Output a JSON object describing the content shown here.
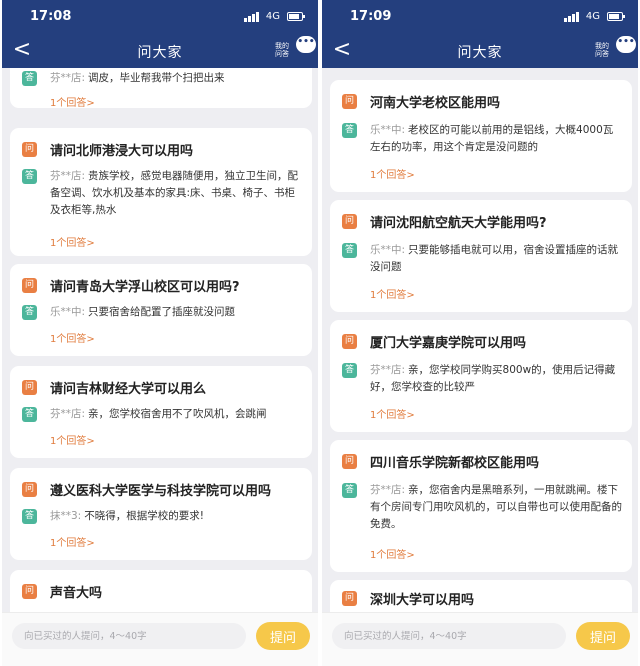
{
  "left": {
    "status": {
      "time": "17:08",
      "network": "4G"
    },
    "nav": {
      "back": "<",
      "title": "问大家",
      "my_questions": "我的问答",
      "chat": "•••"
    },
    "cards": [
      {
        "answer_user": "芬**店:",
        "answer": "调皮，毕业帮我带个扫把出来",
        "count": "1个回答>"
      },
      {
        "question": "请问北师港浸大可以用吗",
        "answer_user": "芬**店:",
        "answer": "贵族学校，感觉电器随便用，独立卫生间，配备空调、饮水机及基本的家具:床、书桌、椅子、书柜及衣柜等,热水",
        "count": "1个回答>"
      },
      {
        "question": "请问青岛大学浮山校区可以用吗?",
        "answer_user": "乐**中:",
        "answer": "只要宿舍给配置了插座就没问题",
        "count": "1个回答>"
      },
      {
        "question": "请问吉林财经大学可以用么",
        "answer_user": "芬**店:",
        "answer": "亲，您学校宿舍用不了吹风机，会跳闸",
        "count": "1个回答>"
      },
      {
        "question": "遵义医科大学医学与科技学院可以用吗",
        "answer_user": "抹**3:",
        "answer": "不晓得，根据学校的要求!",
        "count": "1个回答>"
      },
      {
        "question": "声音大吗"
      }
    ],
    "bottom": {
      "placeholder": "向已买过的人提问，4～40字",
      "ask": "提问"
    }
  },
  "right": {
    "status": {
      "time": "17:09",
      "network": "4G"
    },
    "nav": {
      "back": "<",
      "title": "问大家",
      "my_questions": "我的问答",
      "chat": "•••"
    },
    "cards": [
      {
        "question": "河南大学老校区能用吗",
        "answer_user": "乐**中:",
        "answer": "老校区的可能以前用的是铝线，大概4000瓦左右的功率，用这个肯定是没问题的",
        "count": "1个回答>"
      },
      {
        "question": "请问沈阳航空航天大学能用吗?",
        "answer_user": "乐**中:",
        "answer": "只要能够插电就可以用，宿舍设置插座的话就没问题",
        "count": "1个回答>"
      },
      {
        "question": "厦门大学嘉庚学院可以用吗",
        "answer_user": "芬**店:",
        "answer": "亲，您学校同学购买800w的，使用后记得藏好，您学校查的比较严",
        "count": "1个回答>"
      },
      {
        "question": "四川音乐学院新都校区能用吗",
        "answer_user": "芬**店:",
        "answer": "亲，您宿舍内是黑暗系列，一用就跳闸。楼下有个房间专门用吹风机的，可以自带也可以使用配备的免费。",
        "count": "1个回答>"
      },
      {
        "question": "深圳大学可以用吗"
      }
    ],
    "bottom": {
      "placeholder": "向已买过的人提问，4～40字",
      "ask": "提问"
    }
  },
  "badges": {
    "question": "问",
    "answer": "答"
  },
  "colors": {
    "header": "#243f7e",
    "question_badge": "#e97f43",
    "answer_badge": "#4cb69b",
    "answer_count": "#e07b3c",
    "ask_button": "#f6c84a",
    "background": "#eeeef2"
  },
  "icons": [
    "back-arrow-icon",
    "signal-icon",
    "battery-icon",
    "chat-bubble-icon"
  ]
}
